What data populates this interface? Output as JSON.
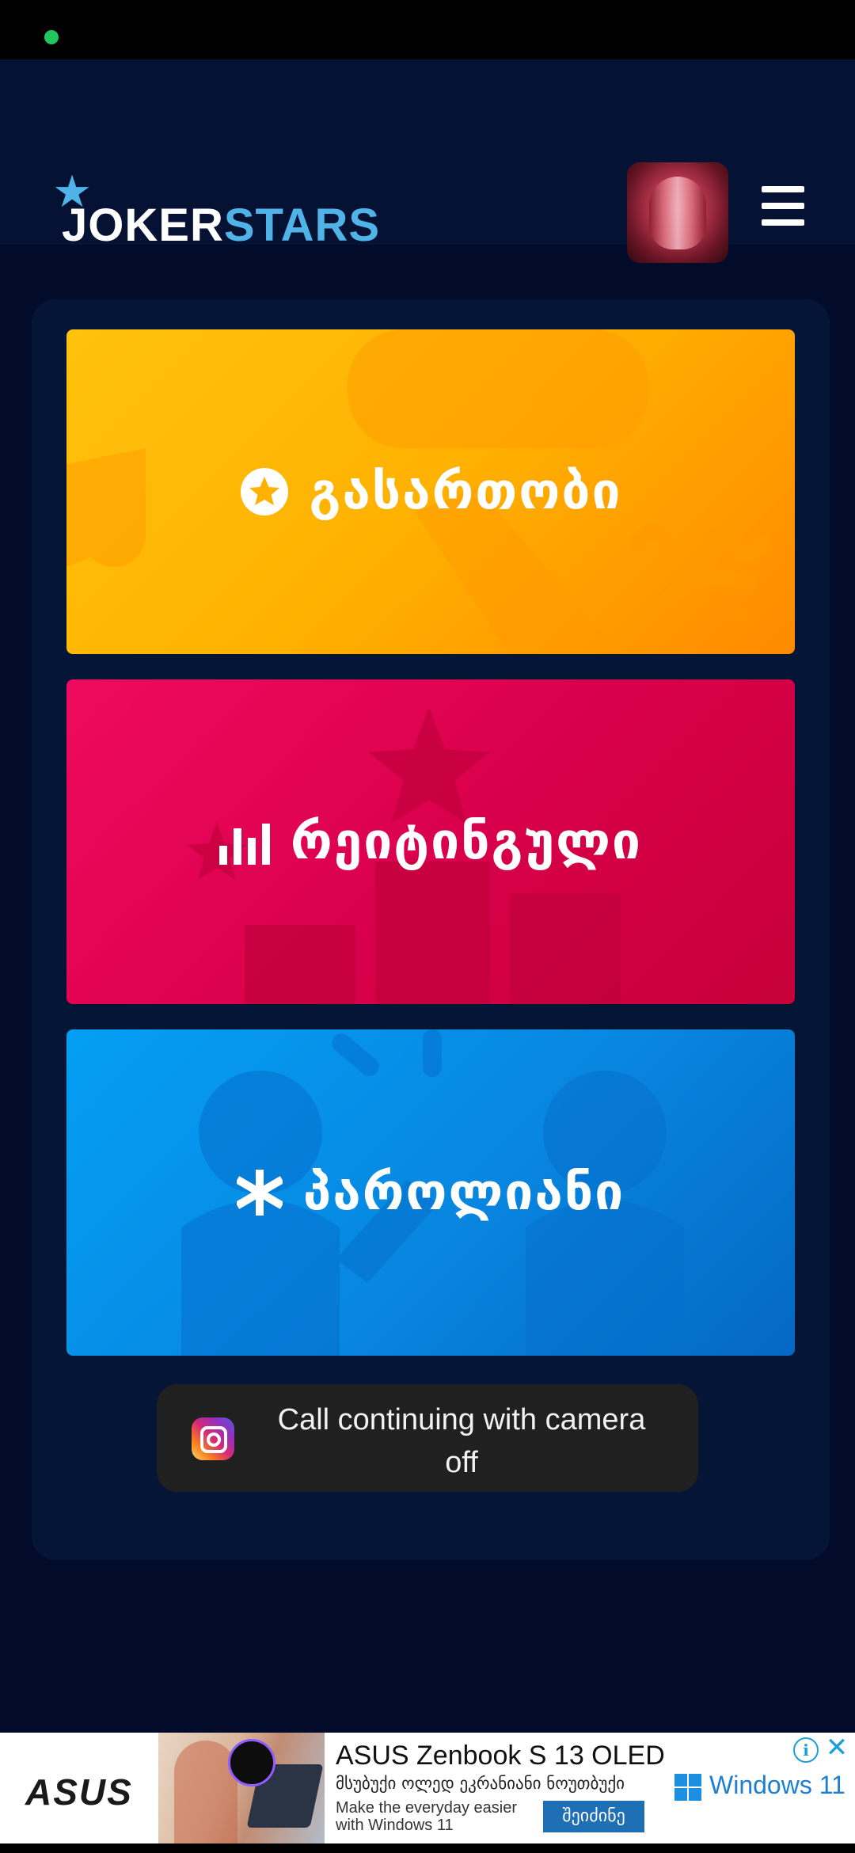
{
  "brand": {
    "logo_white": "JOKER",
    "logo_blue": "STARS"
  },
  "header": {
    "avatar_alt": "profile avatar",
    "menu_icon": "hamburger-menu-icon"
  },
  "categories": [
    {
      "label": "გასართობი",
      "icon": "star-circle-icon",
      "color": "#ffb100"
    },
    {
      "label": "რეიტინგული",
      "icon": "bar-chart-icon",
      "color": "#dc004c"
    },
    {
      "label": "პაროლიანი",
      "icon": "asterisk-icon",
      "color": "#0886e0"
    }
  ],
  "toast": {
    "message": "Call continuing with camera off",
    "icon": "instagram-icon"
  },
  "ad": {
    "brand": "ASUS",
    "title": "ASUS Zenbook S 13 OLED",
    "subtitle": "მსუბუქი ოლედ ეკრანიანი ნოუთბუქი",
    "tagline": "Make the everyday easier with Windows 11",
    "cta": "შეიძინე",
    "partner": "Windows 11"
  }
}
